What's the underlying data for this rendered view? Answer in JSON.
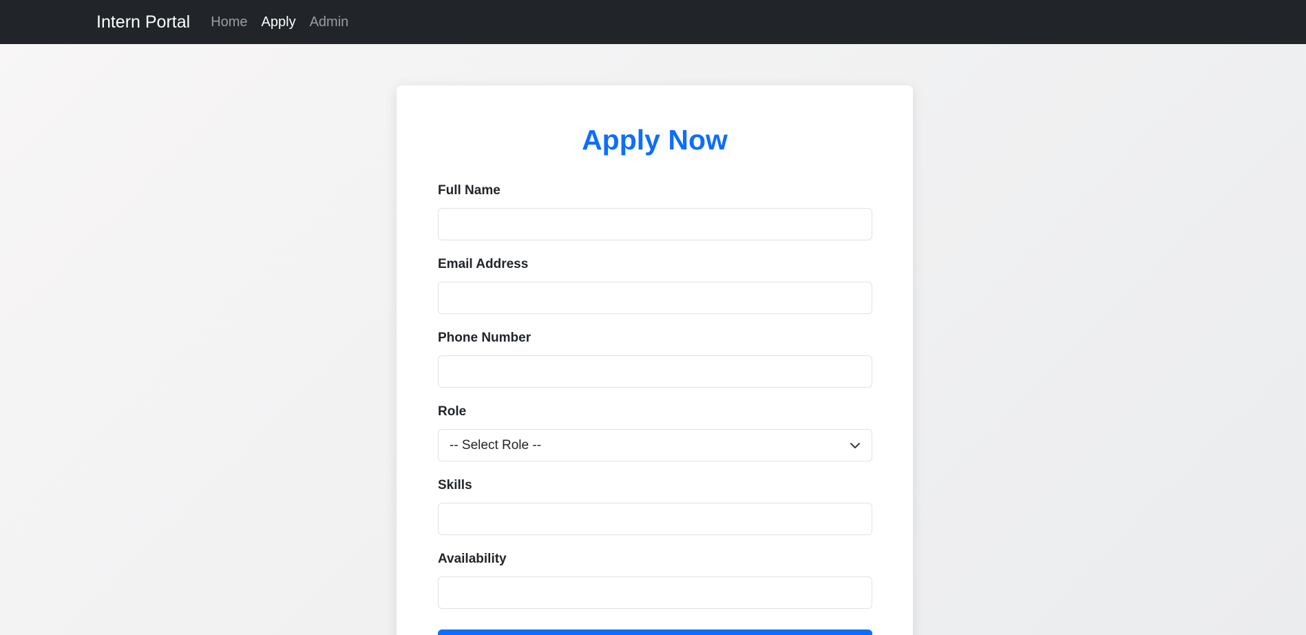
{
  "navbar": {
    "brand": "Intern Portal",
    "links": [
      {
        "label": "Home",
        "active": false
      },
      {
        "label": "Apply",
        "active": true
      },
      {
        "label": "Admin",
        "active": false
      }
    ]
  },
  "form": {
    "title": "Apply Now",
    "fields": {
      "full_name": {
        "label": "Full Name",
        "value": ""
      },
      "email": {
        "label": "Email Address",
        "value": ""
      },
      "phone": {
        "label": "Phone Number",
        "value": ""
      },
      "role": {
        "label": "Role",
        "selected": "-- Select Role --"
      },
      "skills": {
        "label": "Skills",
        "value": ""
      },
      "availability": {
        "label": "Availability",
        "value": ""
      }
    },
    "submit_label": ""
  },
  "colors": {
    "navbar_bg": "#212529",
    "accent": "#0d6efd",
    "card_bg": "#ffffff"
  }
}
